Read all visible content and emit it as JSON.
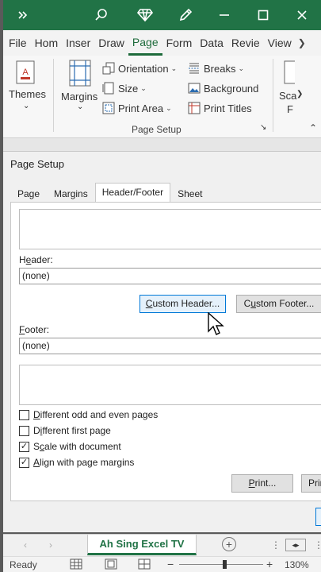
{
  "titlebar": {
    "icons": [
      "chevron-double-right-icon",
      "search-icon",
      "diamond-icon",
      "pen-icon",
      "minimize-icon",
      "restore-icon",
      "close-icon"
    ],
    "color": "#217346"
  },
  "ribbon_tabs": [
    "File",
    "Hom",
    "Inser",
    "Draw",
    "Page",
    "Form",
    "Data",
    "Revie",
    "View"
  ],
  "active_tab": "Page",
  "ribbon": {
    "themes_label": "Themes",
    "margins_label": "Margins",
    "orientation_label": "Orientation",
    "size_label": "Size",
    "print_area_label": "Print Area",
    "breaks_label": "Breaks",
    "background_label": "Background",
    "print_titles_label": "Print Titles",
    "scale_label_1": "Sca",
    "scale_label_2": "F",
    "group_label": "Page Setup"
  },
  "dialog": {
    "title": "Page Setup",
    "tabs": [
      "Page",
      "Margins",
      "Header/Footer",
      "Sheet"
    ],
    "active_tab": "Header/Footer",
    "header_label": "Header:",
    "header_value": "(none)",
    "custom_header_button": "Custom Header...",
    "custom_footer_button": "Custom Footer...",
    "footer_label": "Footer:",
    "footer_value": "(none)",
    "checkboxes": [
      {
        "label": "Different odd and even pages",
        "checked": false
      },
      {
        "label": "Different first page",
        "checked": false
      },
      {
        "label": "Scale with document",
        "checked": true
      },
      {
        "label": "Align with page margins",
        "checked": true
      }
    ],
    "print_button": "Print...",
    "print_preview_button": "Prin"
  },
  "sheetbar": {
    "sheet_name": "Ah Sing Excel TV"
  },
  "statusbar": {
    "status": "Ready",
    "zoom": "130%"
  }
}
